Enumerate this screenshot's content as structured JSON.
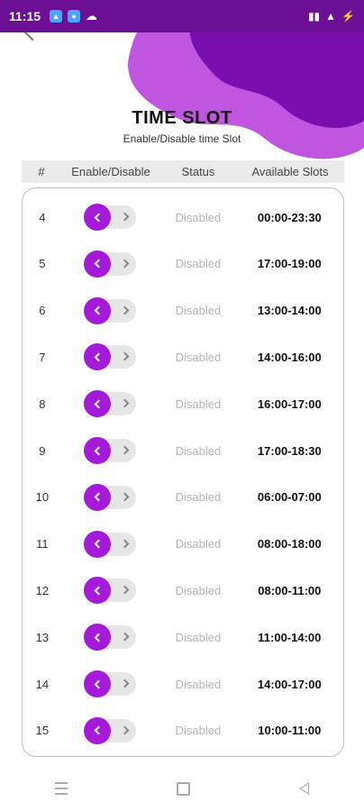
{
  "status_bar": {
    "time": "11:15",
    "right_text": "ⓘ ▮▮ .∥∥ ⚡"
  },
  "header": {
    "title": "TIME SLOT",
    "subtitle": "Enable/Disable time Slot"
  },
  "columns": {
    "num": "#",
    "toggle": "Enable/Disable",
    "status": "Status",
    "slots": "Available Slots"
  },
  "rows": [
    {
      "num": "4",
      "status": "Disabled",
      "slot": "00:00-23:30"
    },
    {
      "num": "5",
      "status": "Disabled",
      "slot": "17:00-19:00"
    },
    {
      "num": "6",
      "status": "Disabled",
      "slot": "13:00-14:00"
    },
    {
      "num": "7",
      "status": "Disabled",
      "slot": "14:00-16:00"
    },
    {
      "num": "8",
      "status": "Disabled",
      "slot": "16:00-17:00"
    },
    {
      "num": "9",
      "status": "Disabled",
      "slot": "17:00-18:30"
    },
    {
      "num": "10",
      "status": "Disabled",
      "slot": "06:00-07:00"
    },
    {
      "num": "11",
      "status": "Disabled",
      "slot": "08:00-18:00"
    },
    {
      "num": "12",
      "status": "Disabled",
      "slot": "08:00-11:00"
    },
    {
      "num": "13",
      "status": "Disabled",
      "slot": "11:00-14:00"
    },
    {
      "num": "14",
      "status": "Disabled",
      "slot": "14:00-17:00"
    },
    {
      "num": "15",
      "status": "Disabled",
      "slot": "10:00-11:00"
    }
  ],
  "icons": {
    "back": "back-arrow-icon",
    "nav_menu": "menu-icon",
    "nav_home": "home-icon",
    "nav_back": "back-icon"
  },
  "colors": {
    "accent": "#a41ad8",
    "status_bar": "#6b0f94",
    "blob_light": "#c055e0",
    "blob_dark": "#7a0fb0"
  }
}
